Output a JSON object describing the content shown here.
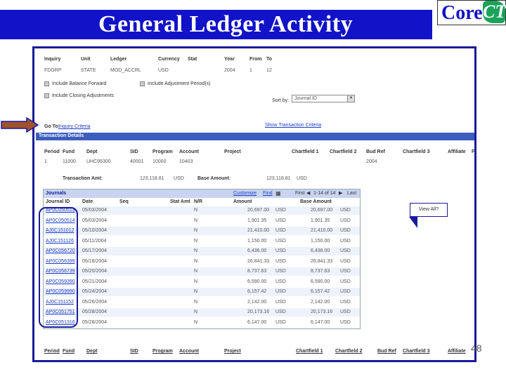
{
  "slide": {
    "title": "General Ledger Activity",
    "logo_core": "Core-",
    "logo_ct": "CT",
    "page_number": "48"
  },
  "criteria": {
    "headers": [
      "Inquiry",
      "Unit",
      "Ledger",
      "Currency",
      "Stat",
      "Year",
      "From",
      "To"
    ],
    "values": [
      "FDGRP",
      "STATE",
      "MOD_ACCRL",
      "USD",
      "",
      "2004",
      "1",
      "12"
    ],
    "include_balance_forward": "Include Balance Forward",
    "include_adjustment_periods": "Include Adjustment Period(s)",
    "include_closing_adjustments": "Include Closing Adjustments",
    "sort_by_label": "Sort by:",
    "sort_by_value": "Journal ID",
    "go_to_label": "Go To:",
    "go_to_link": "Inquiry Criteria",
    "show_transaction_criteria": "Show Transaction Criteria"
  },
  "transaction_details": {
    "section_title": "Transaction Details",
    "headers": [
      "Period",
      "Fund",
      "Dept",
      "SID",
      "Program",
      "Account",
      "Project",
      "Chartfield 1",
      "Chartfield 2",
      "Bud Ref",
      "Chartfield 3",
      "Affiliate",
      "F"
    ],
    "values": [
      "1",
      "11000",
      "UHC95300",
      "40001",
      "10000",
      "10403",
      "",
      "",
      "",
      "2004",
      "",
      "",
      ""
    ],
    "transaction_amt_label": "Transaction Amt:",
    "transaction_amt": "123,118.81",
    "transaction_currency": "USD",
    "base_amount_label": "Base Amount:",
    "base_amount": "123,118.81",
    "base_currency": "USD"
  },
  "journals": {
    "title": "Journals",
    "customize": "Customize",
    "find": "Find",
    "first": "First",
    "range": "1-14 of 14",
    "last": "Last",
    "headers": [
      "Journal ID",
      "Date",
      "Seq",
      "Stat Amt",
      "N/R",
      "Amount",
      "Base Amount"
    ],
    "rows": [
      {
        "id": "AP0C050513",
        "date": "05/03/2004",
        "seq": "",
        "nr": "N",
        "amount": "20,697.00",
        "cur": "USD",
        "base": "20,697.00",
        "bcur": "USD"
      },
      {
        "id": "AP0C050514",
        "date": "05/03/2004",
        "seq": "",
        "nr": "N",
        "amount": "1,901.35",
        "cur": "USD",
        "base": "1,901.35",
        "bcur": "USD"
      },
      {
        "id": "AJ0C151012",
        "date": "05/10/2004",
        "seq": "",
        "nr": "N",
        "amount": "21,410.00",
        "cur": "USD",
        "base": "21,410.00",
        "bcur": "USD"
      },
      {
        "id": "AJ0C151126",
        "date": "05/11/2004",
        "seq": "",
        "nr": "N",
        "amount": "1,150.00",
        "cur": "USD",
        "base": "1,150.00",
        "bcur": "USD"
      },
      {
        "id": "AP0C056720",
        "date": "05/17/2004",
        "seq": "",
        "nr": "N",
        "amount": "6,436.00",
        "cur": "USD",
        "base": "6,436.00",
        "bcur": "USD"
      },
      {
        "id": "AP0C056399",
        "date": "05/18/2004",
        "seq": "",
        "nr": "N",
        "amount": "26,841.33",
        "cur": "USD",
        "base": "26,841.33",
        "bcur": "USD"
      },
      {
        "id": "AP0C056739",
        "date": "05/20/2004",
        "seq": "",
        "nr": "N",
        "amount": "8,737.63",
        "cur": "USD",
        "base": "8,737.63",
        "bcur": "USD"
      },
      {
        "id": "AP0C059390",
        "date": "05/21/2004",
        "seq": "",
        "nr": "N",
        "amount": "6,590.00",
        "cur": "USD",
        "base": "6,590.00",
        "bcur": "USD"
      },
      {
        "id": "AP0C059990",
        "date": "05/24/2004",
        "seq": "",
        "nr": "N",
        "amount": "6,157.42",
        "cur": "USD",
        "base": "6,157.42",
        "bcur": "USD"
      },
      {
        "id": "AJ0C151152",
        "date": "05/26/2004",
        "seq": "",
        "nr": "N",
        "amount": "2,142.00",
        "cur": "USD",
        "base": "2,142.00",
        "bcur": "USD"
      },
      {
        "id": "AP0C051751",
        "date": "05/28/2004",
        "seq": "",
        "nr": "N",
        "amount": "20,173.16",
        "cur": "USD",
        "base": "20,173.16",
        "bcur": "USD"
      },
      {
        "id": "AP0C051316",
        "date": "05/28/2004",
        "seq": "",
        "nr": "N",
        "amount": "6,147.00",
        "cur": "USD",
        "base": "6,147.00",
        "bcur": "USD"
      }
    ]
  },
  "footer_headers": [
    "Period",
    "Fund",
    "Dept",
    "SID",
    "Program",
    "Account",
    "Project",
    "Chartfield 1",
    "Chartfield 2",
    "Bud Ref",
    "Chartfield 3",
    "Affiliate"
  ],
  "callout_text": "View All?",
  "colors": {
    "title_blue": "#1212c8",
    "frame": "#1a1a9a",
    "section_bar": "#3b5dbd",
    "arrow": "#a0522d"
  }
}
